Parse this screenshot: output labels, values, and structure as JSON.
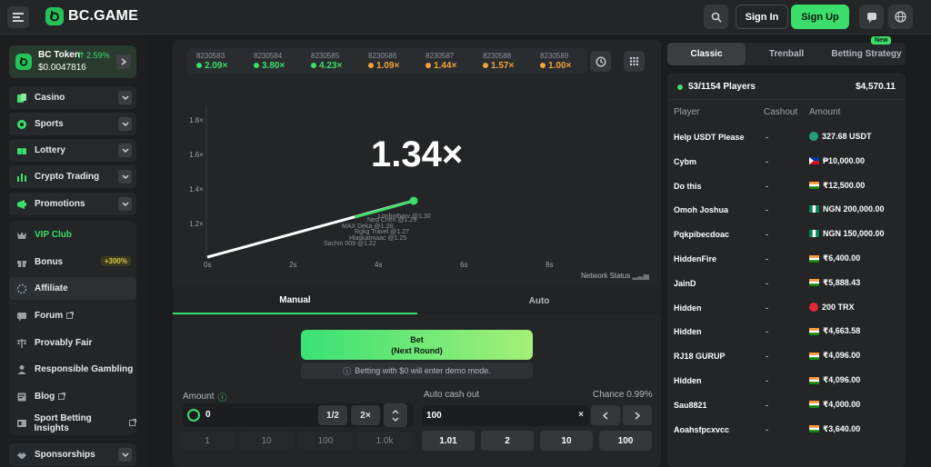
{
  "header": {
    "logo_text": "BC.GAME",
    "signin_label": "Sign In",
    "signup_label": "Sign Up",
    "accent_color": "#3bde6a"
  },
  "sidebar": {
    "token": {
      "name": "BC Token",
      "change": "2.59%",
      "price": "$0.0047816"
    },
    "groups1": [
      {
        "label": "Casino",
        "icon": "casino-icon"
      },
      {
        "label": "Sports",
        "icon": "sports-icon"
      },
      {
        "label": "Lottery",
        "icon": "lottery-icon"
      },
      {
        "label": "Crypto Trading",
        "icon": "chart-icon"
      },
      {
        "label": "Promotions",
        "icon": "promotions-icon"
      }
    ],
    "vip_label": "VIP Club",
    "bonus_label": "Bonus",
    "bonus_badge": "+300%",
    "affiliate_label": "Affiliate",
    "forum_label": "Forum",
    "provably_label": "Provably Fair",
    "responsible_label": "Responsible Gambling",
    "blog_label": "Blog",
    "insights_label": "Sport Betting Insights",
    "sponsorships_label": "Sponsorships"
  },
  "history": [
    {
      "id": "8230583",
      "value": "2.09×",
      "color": "#3bde6a"
    },
    {
      "id": "8230584",
      "value": "3.80×",
      "color": "#3bde6a"
    },
    {
      "id": "8230585",
      "value": "4.23×",
      "color": "#3bde6a"
    },
    {
      "id": "8230586",
      "value": "1.09×",
      "color": "#f2a33a"
    },
    {
      "id": "8230587",
      "value": "1.44×",
      "color": "#f2a33a"
    },
    {
      "id": "8230588",
      "value": "1.57×",
      "color": "#f2a33a"
    },
    {
      "id": "8230589",
      "value": "1.00×",
      "color": "#f2a33a"
    }
  ],
  "game": {
    "multiplier": "1.34×",
    "y_ticks": [
      "1.8×",
      "1.6×",
      "1.4×",
      "1.2×"
    ],
    "x_ticks": [
      "0s",
      "2s",
      "4s",
      "6s",
      "8s"
    ],
    "labels_cashout": [
      "Sachin 009 @1.22",
      "Hlaskatmaac @1.25",
      "Rgkg Travel @1.27",
      "MAX Deka @1.28",
      "Ned Chen @1.29",
      "Lonbotharv @1.30"
    ],
    "network_status": "Network Status"
  },
  "bet": {
    "tab_manual": "Manual",
    "tab_auto": "Auto",
    "bet_label": "Bet",
    "bet_sub": "(Next Round)",
    "demo_note": "Betting with $0 will enter demo mode.",
    "amount_label": "Amount",
    "amount_value": "0",
    "half_label": "1/2",
    "double_label": "2×",
    "presets": [
      "1",
      "10",
      "100",
      "1.0k"
    ],
    "cashout_label": "Auto cash out",
    "chance_label": "Chance 0.99%",
    "cashout_value": "100",
    "cashout_x": "×",
    "cashout_presets": [
      "1.01",
      "2",
      "10",
      "100"
    ]
  },
  "right": {
    "tabs": [
      "Classic",
      "Trenball",
      "Betting Strategy"
    ],
    "new_badge": "New",
    "players_count": "53/1154 Players",
    "total": "$4,570.11",
    "col_player": "Player",
    "col_cashout": "Cashout",
    "col_amount": "Amount",
    "players": [
      {
        "name": "Help USDT Please",
        "cashout": "-",
        "amount": "327.68 USDT",
        "icon": "usdt"
      },
      {
        "name": "Cybm",
        "cashout": "-",
        "amount": "₱10,000.00",
        "icon": "ph"
      },
      {
        "name": "Do this",
        "cashout": "-",
        "amount": "₹12,500.00",
        "icon": "in"
      },
      {
        "name": "Omoh Joshua",
        "cashout": "-",
        "amount": "NGN 200,000.00",
        "icon": "ng"
      },
      {
        "name": "Pqkpibecdoac",
        "cashout": "-",
        "amount": "NGN 150,000.00",
        "icon": "ng"
      },
      {
        "name": "HiddenFire",
        "cashout": "-",
        "amount": "₹6,400.00",
        "icon": "in"
      },
      {
        "name": "JainD",
        "cashout": "-",
        "amount": "₹5,888.43",
        "icon": "in"
      },
      {
        "name": "Hidden",
        "cashout": "-",
        "amount": "200 TRX",
        "icon": "trx"
      },
      {
        "name": "Hidden",
        "cashout": "-",
        "amount": "₹4,663.58",
        "icon": "in"
      },
      {
        "name": "RJ18 GURUP",
        "cashout": "-",
        "amount": "₹4,096.00",
        "icon": "in"
      },
      {
        "name": "Hidden",
        "cashout": "-",
        "amount": "₹4,096.00",
        "icon": "in"
      },
      {
        "name": "Sau8821",
        "cashout": "-",
        "amount": "₹4,000.00",
        "icon": "in"
      },
      {
        "name": "Aoahsfpcxvcc",
        "cashout": "-",
        "amount": "₹3,640.00",
        "icon": "in"
      }
    ]
  }
}
